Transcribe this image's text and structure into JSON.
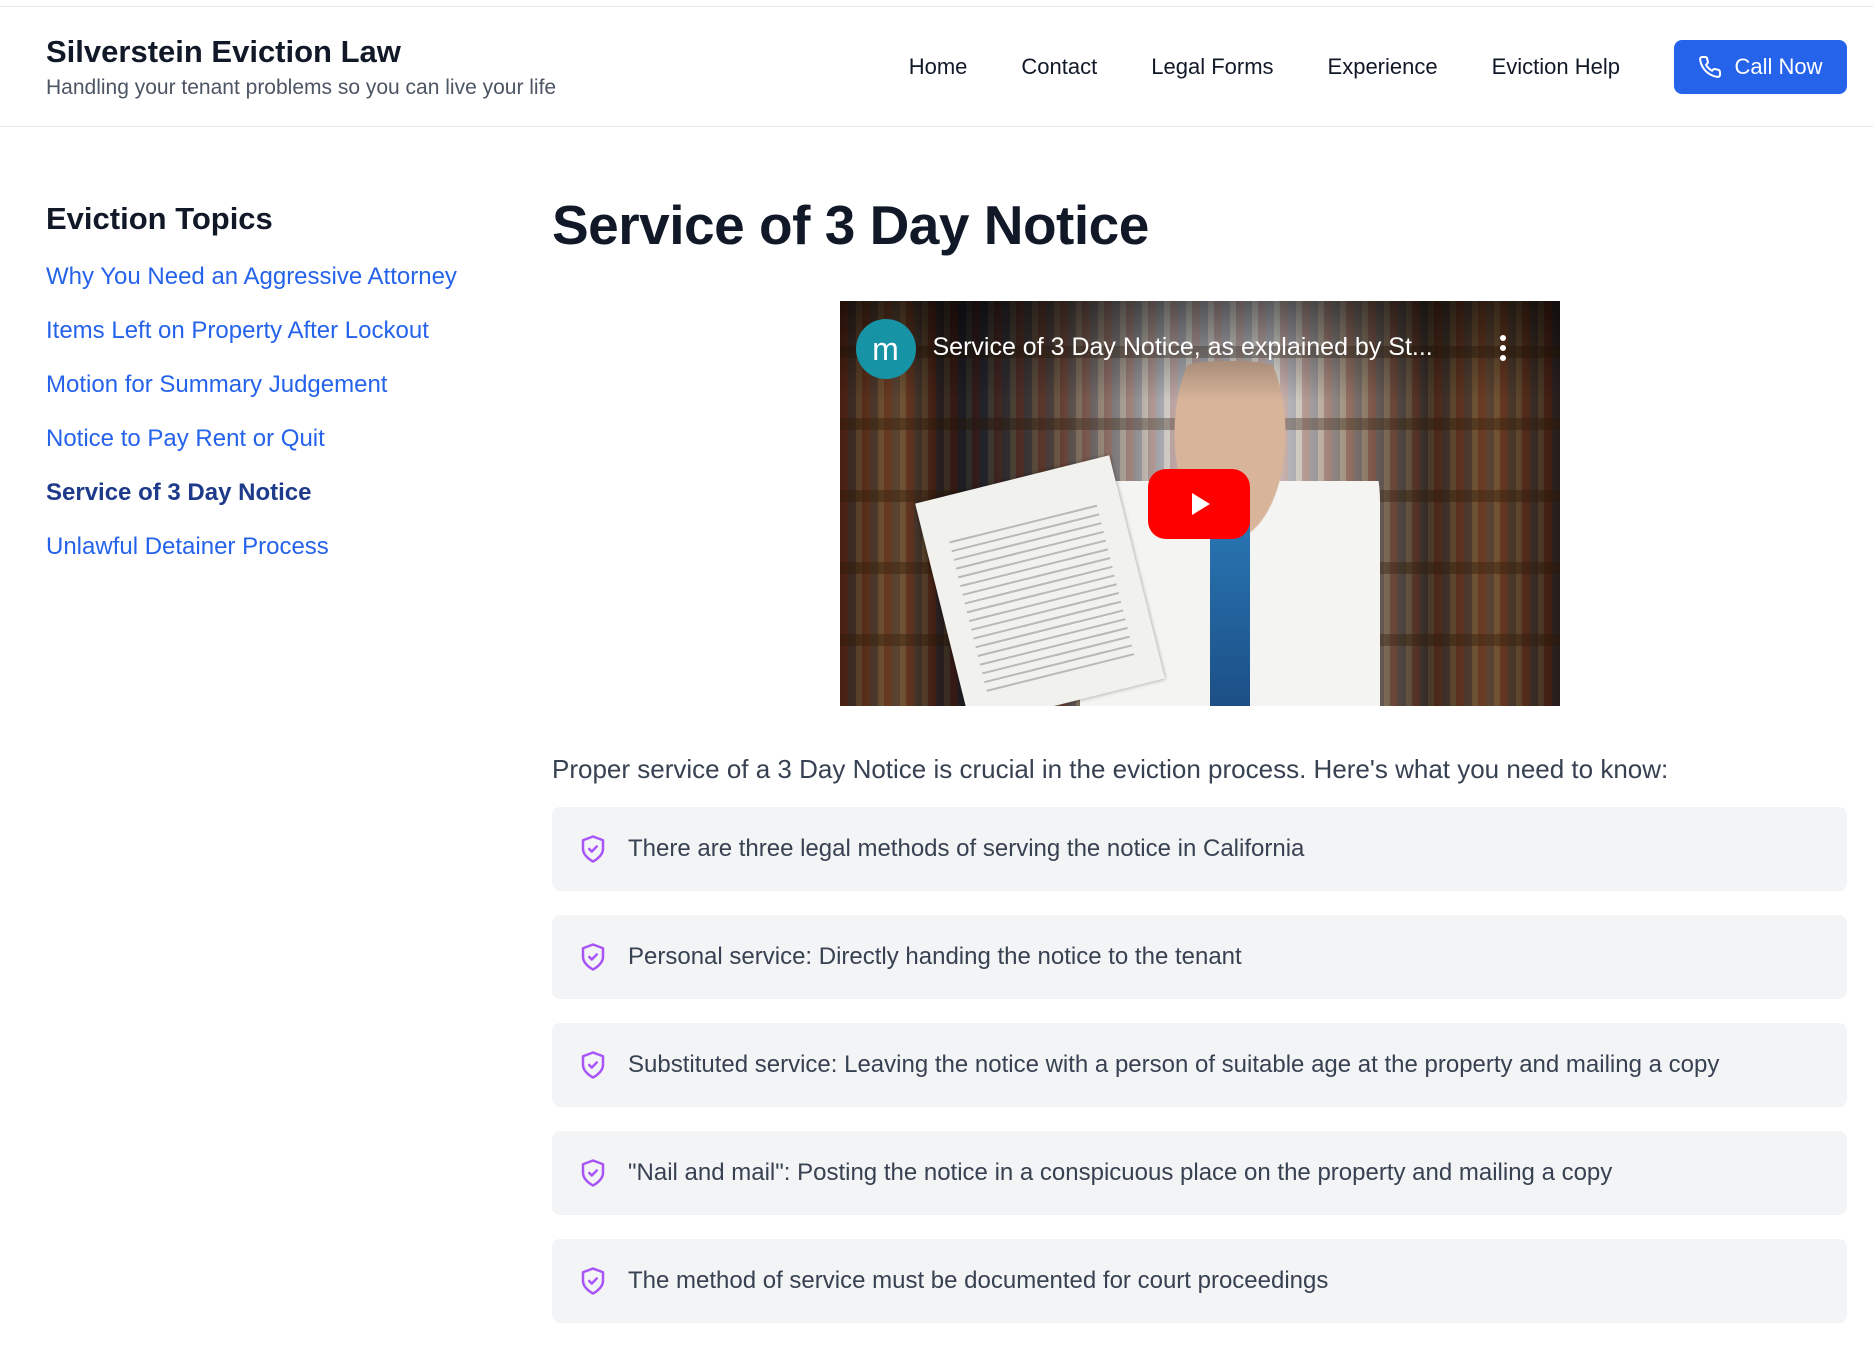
{
  "brand": {
    "title": "Silverstein Eviction Law",
    "tagline": "Handling your tenant problems so you can live your life"
  },
  "nav": {
    "items": [
      "Home",
      "Contact",
      "Legal Forms",
      "Experience",
      "Eviction Help"
    ],
    "cta_label": "Call Now"
  },
  "sidebar": {
    "heading": "Eviction Topics",
    "items": [
      {
        "label": "Why You Need an Aggressive Attorney",
        "active": false
      },
      {
        "label": "Items Left on Property After Lockout",
        "active": false
      },
      {
        "label": "Motion for Summary Judgement",
        "active": false
      },
      {
        "label": "Notice to Pay Rent or Quit",
        "active": false
      },
      {
        "label": "Service of 3 Day Notice",
        "active": true
      },
      {
        "label": "Unlawful Detainer Process",
        "active": false
      }
    ]
  },
  "main": {
    "title": "Service of 3 Day Notice",
    "video": {
      "channel_initial": "m",
      "title": "Service of 3 Day Notice, as explained by St..."
    },
    "intro": "Proper service of a 3 Day Notice is crucial in the eviction process. Here's what you need to know:",
    "points": [
      "There are three legal methods of serving the notice in California",
      "Personal service: Directly handing the notice to the tenant",
      "Substituted service: Leaving the notice with a person of suitable age at the property and mailing a copy",
      "\"Nail and mail\": Posting the notice in a conspicuous place on the property and mailing a copy",
      "The method of service must be documented for court proceedings"
    ]
  },
  "colors": {
    "accent": "#2563eb",
    "link": "#2563eb",
    "active_link": "#1e3a8a",
    "shield_icon": "#a855f7",
    "play_button": "#ff0000"
  },
  "icons": {
    "cta": "phone-icon",
    "bullet": "shield-check-icon",
    "video_menu": "kebab-menu-icon",
    "video_play": "play-icon"
  }
}
